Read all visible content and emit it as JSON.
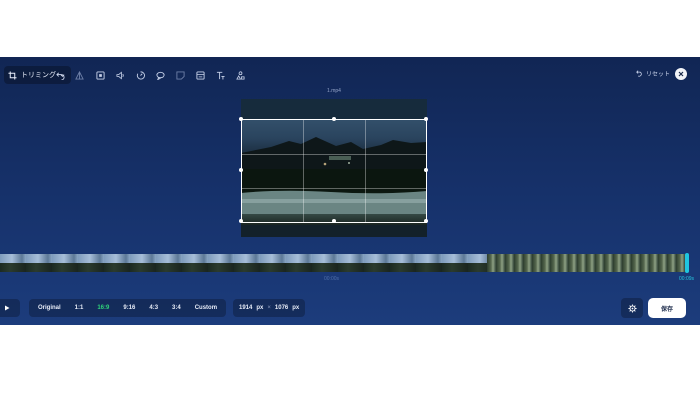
{
  "toolbar": {
    "trim_label": "トリミング",
    "tools": [
      {
        "name": "undo-icon"
      },
      {
        "name": "triangle-icon"
      },
      {
        "name": "frame-icon"
      },
      {
        "name": "volume-icon"
      },
      {
        "name": "speed-icon"
      },
      {
        "name": "loop-icon"
      },
      {
        "name": "sticker-icon"
      },
      {
        "name": "filter-icon"
      },
      {
        "name": "text-icon"
      },
      {
        "name": "shapes-icon"
      }
    ],
    "reset_label": "リセット"
  },
  "preview": {
    "filename": "1.mp4"
  },
  "timeline": {
    "start_time": "00:00s",
    "end_time": "00:09s"
  },
  "aspect_ratios": {
    "options": [
      "Original",
      "1:1",
      "16:9",
      "9:16",
      "4:3",
      "3:4",
      "Custom"
    ],
    "selected": "16:9"
  },
  "size": {
    "width": "1914",
    "height": "1076",
    "unit": "px",
    "separator": "×"
  },
  "actions": {
    "save_label": "保存"
  },
  "colors": {
    "background": "#16316a",
    "accent_active": "#2fd47a",
    "playhead": "#1fc6e0"
  }
}
